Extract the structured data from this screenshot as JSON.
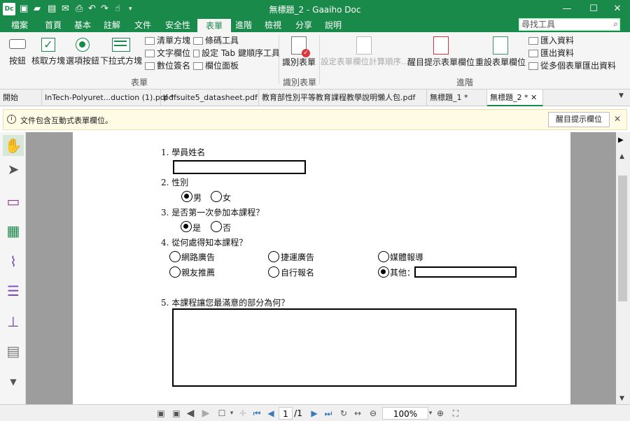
{
  "titlebar": {
    "logo": "Dc",
    "title": "無標題_2 - Gaaiho Doc",
    "qa_icons": [
      "new-file-icon",
      "open-folder-icon",
      "save-icon",
      "mail-icon",
      "print-icon",
      "undo-icon",
      "redo-icon",
      "hand-tool-icon",
      "customize-icon"
    ]
  },
  "menu": [
    "檔案",
    "首頁",
    "基本",
    "註解",
    "文件",
    "安全性",
    "表單",
    "進階",
    "檢視",
    "分享",
    "說明"
  ],
  "search": {
    "placeholder": "尋找工具"
  },
  "ribbon": {
    "big": [
      "按鈕",
      "核取方塊",
      "選項按鈕",
      "下拉式方塊",
      "識別表單",
      "設定表單欄位計算順序...",
      "醒目提示表單欄位",
      "重設表單欄位"
    ],
    "small": [
      "清單方塊",
      "條碼工具",
      "文字欄位",
      "設定 Tab 鍵順序工具",
      "數位簽名",
      "欄位面板",
      "匯入資料",
      "匯出資料",
      "從多個表單匯出資料"
    ],
    "groups": [
      "表單",
      "識別表單",
      "進階"
    ]
  },
  "tabs": [
    "開始",
    "InTech-Polyuret...duction (1).pdf *",
    "pdfsuite5_datasheet.pdf",
    "教育部性別平等教育課程教學說明懶人包.pdf",
    "無標題_1 *",
    "無標題_2 *"
  ],
  "infobar": {
    "message": "文件包含互動式表單欄位。",
    "button": "醒目提示欄位"
  },
  "form": {
    "q1": "1. 學員姓名",
    "q2": "2. 性別",
    "q2_opts": [
      "男",
      "女"
    ],
    "q3": "3. 是否第一次參加本課程？",
    "q3_opts": [
      "是",
      "否"
    ],
    "q4": "4. 從何處得知本課程？",
    "q4_opts": [
      "網路廣告",
      "捷運廣告",
      "媒體報導",
      "親友推薦",
      "自行報名",
      "其他："
    ],
    "q5": "5. 本課程讓您最滿意的部分為何？"
  },
  "statusbar": {
    "page": "1",
    "total": "/1",
    "zoom": "100%"
  },
  "colors": {
    "brand": "#1a8a4a",
    "info_bg": "#fffbe5",
    "doc_bg": "#9d9d9d"
  }
}
